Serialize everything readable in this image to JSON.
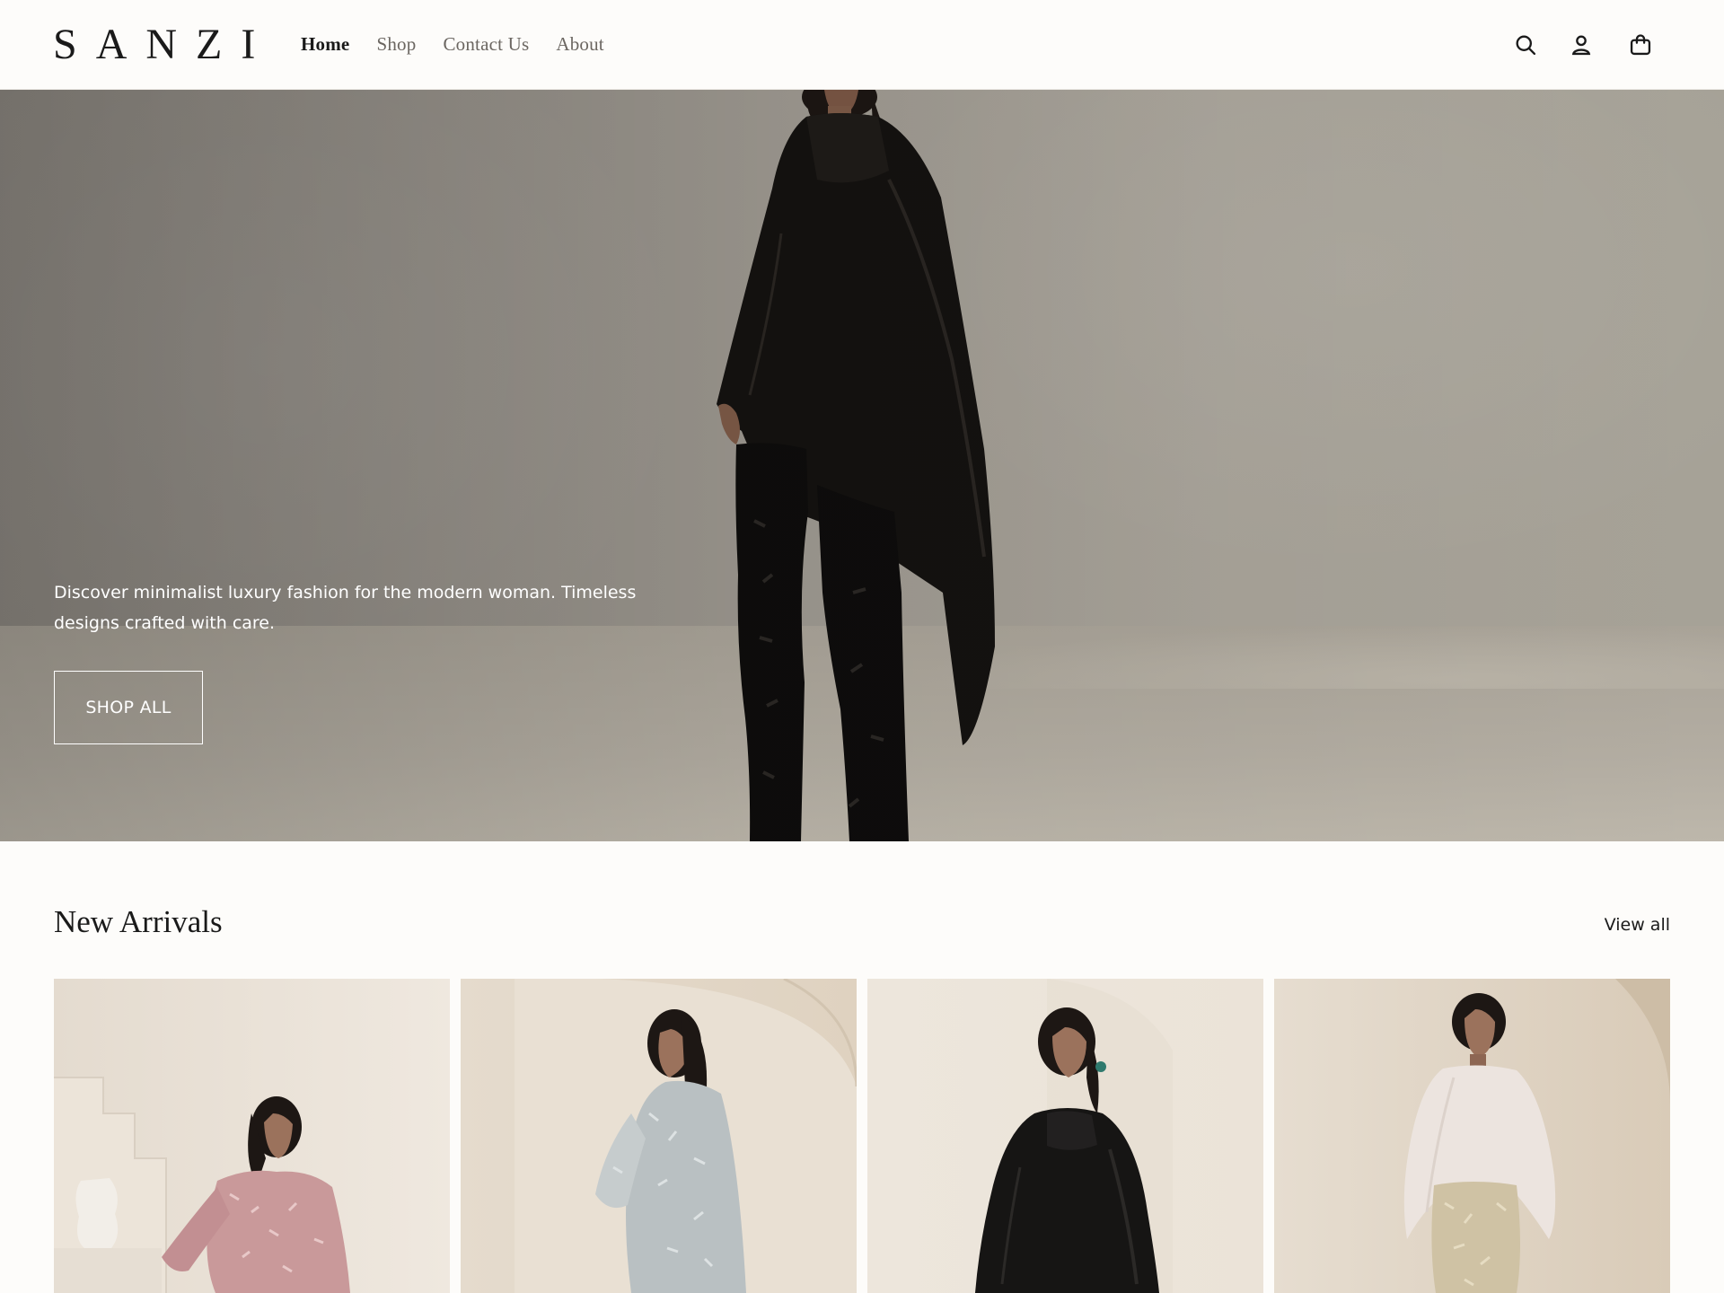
{
  "brand": {
    "logo_text": "SANZI"
  },
  "nav": {
    "items": [
      {
        "label": "Home",
        "active": true
      },
      {
        "label": "Shop",
        "active": false
      },
      {
        "label": "Contact Us",
        "active": false
      },
      {
        "label": "About",
        "active": false
      }
    ]
  },
  "header_icons": [
    "search-icon",
    "account-icon",
    "cart-icon"
  ],
  "hero": {
    "text": "Discover minimalist luxury fashion for the modern woman. Timeless designs crafted with care.",
    "button_label": "SHOP ALL"
  },
  "new_arrivals": {
    "title": "New Arrivals",
    "view_all_label": "View all",
    "products": [
      {
        "garment_color": "#c9999a"
      },
      {
        "garment_color": "#b9c0c2"
      },
      {
        "garment_color": "#161514"
      },
      {
        "garment_color": "#ece4df"
      }
    ]
  },
  "colors": {
    "background": "#fdfcfa",
    "text": "#1a1a1a",
    "nav_inactive": "#6b6661",
    "hero_text": "#ffffff"
  }
}
